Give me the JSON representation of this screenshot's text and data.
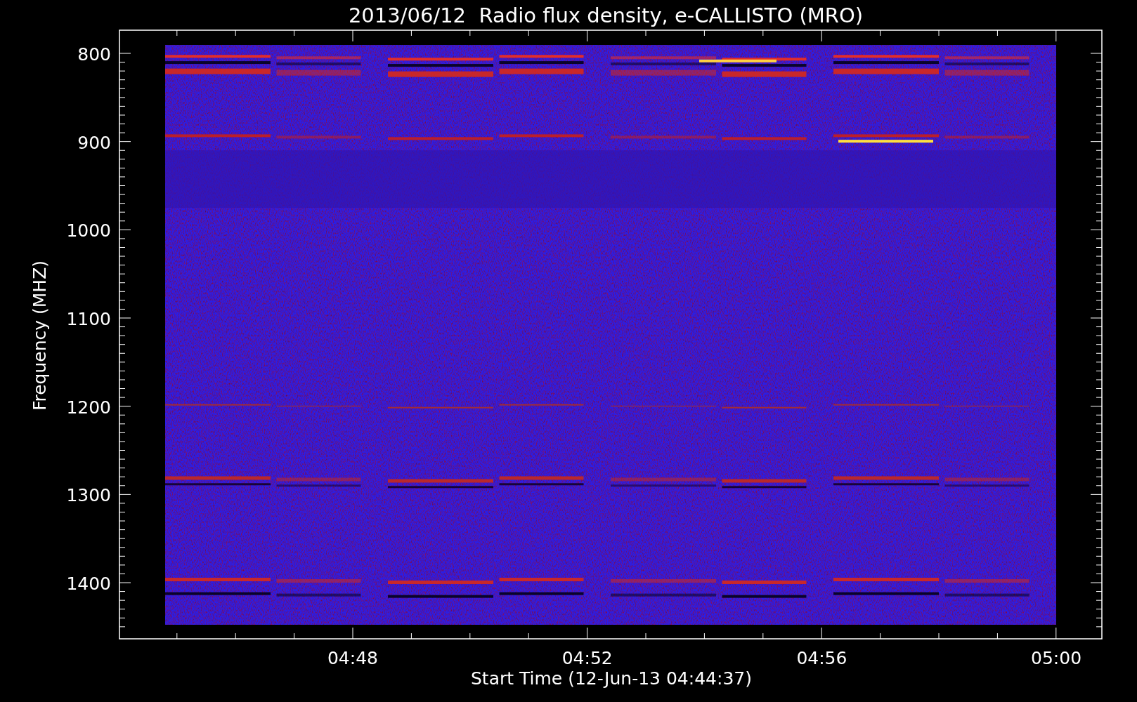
{
  "title": "2013/06/12  Radio flux density, e-CALLISTO (MRO)",
  "y_axis": {
    "label": "Frequency (MHZ)",
    "ticks": [
      "800",
      "900",
      "1000",
      "1100",
      "1200",
      "1300",
      "1400"
    ]
  },
  "x_axis": {
    "label": "Start Time (12-Jun-13 04:44:37)",
    "ticks": [
      "04:48",
      "04:52",
      "04:56",
      "05:00"
    ]
  }
}
